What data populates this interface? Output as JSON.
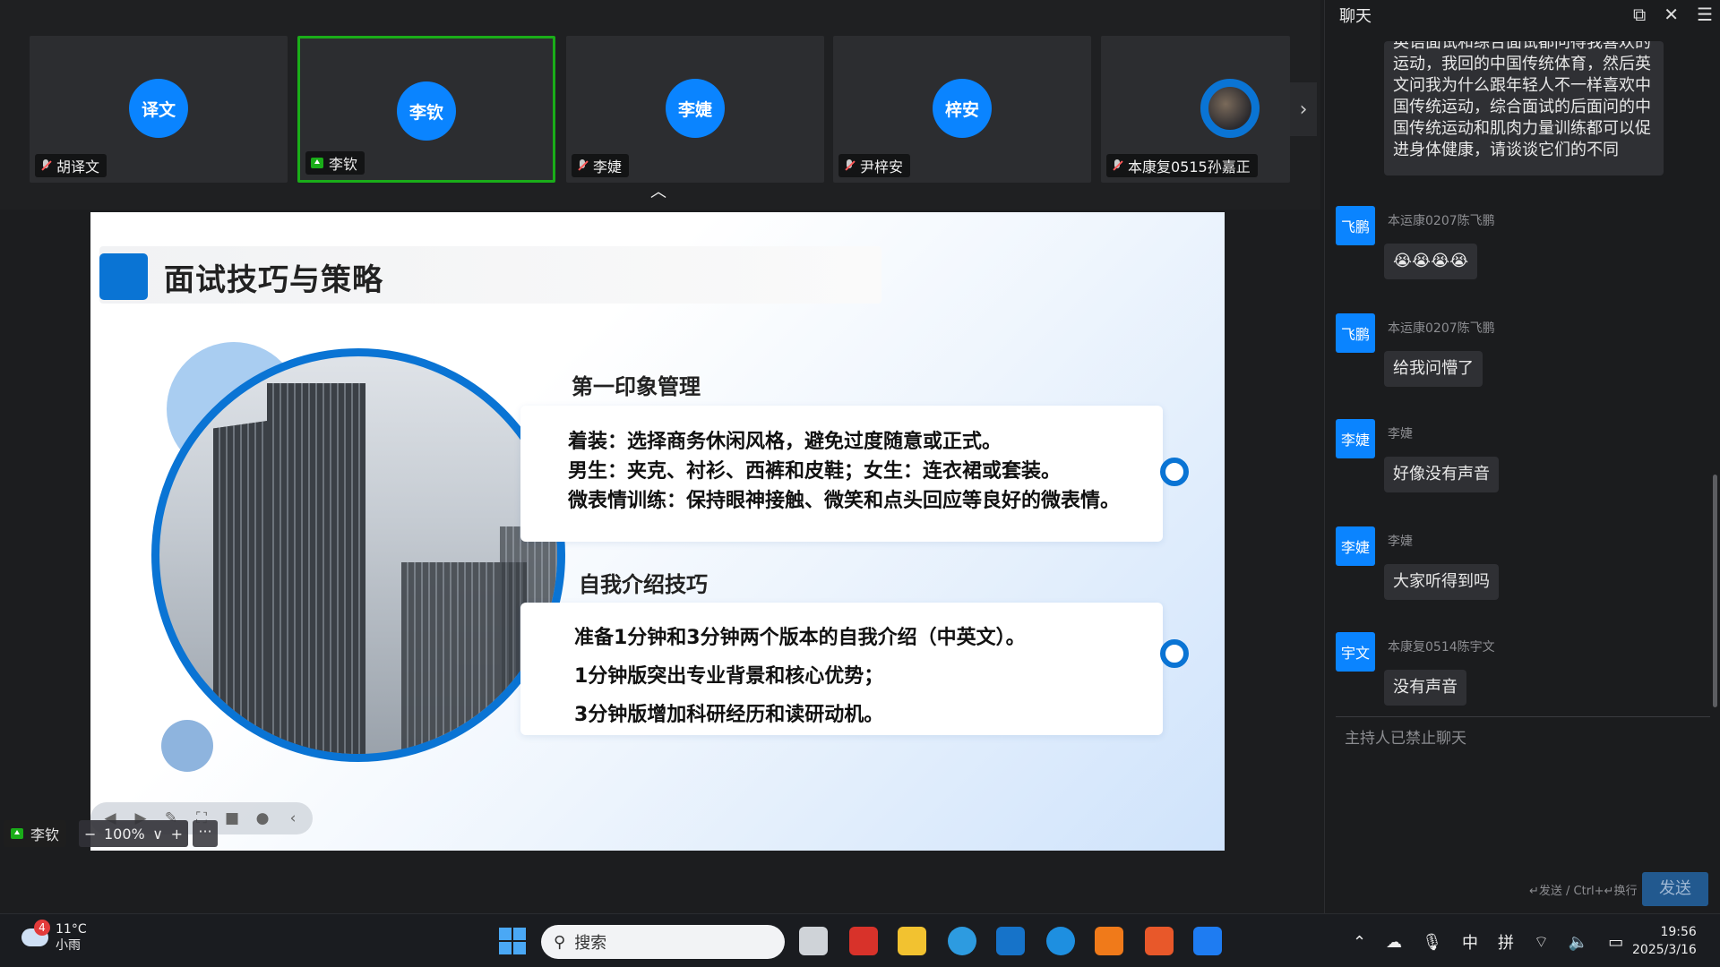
{
  "participants": [
    {
      "avatar": "译文",
      "name": "胡译文",
      "status": "mic-off"
    },
    {
      "avatar": "李钦",
      "name": "李钦",
      "status": "sharing"
    },
    {
      "avatar": "李婕",
      "name": "李婕",
      "status": "mic-off"
    },
    {
      "avatar": "梓安",
      "name": "尹梓安",
      "status": "mic-off"
    },
    {
      "avatar": "",
      "name": "本康复0515孙嘉正",
      "status": "mic-off"
    }
  ],
  "slide": {
    "title": "面试技巧与策略",
    "section1": {
      "title": "第一印象管理",
      "lines": [
        "着装：选择商务休闲风格，避免过度随意或正式。",
        "男生：夹克、衬衫、西裤和皮鞋；女生：连衣裙或套装。",
        "微表情训练：保持眼神接触、微笑和点头回应等良好的微表情。"
      ]
    },
    "section2": {
      "title": "自我介绍技巧",
      "lines": [
        "准备1分钟和3分钟两个版本的自我介绍（中英文）。",
        "1分钟版突出专业背景和核心优势；",
        "3分钟版增加科研经历和读研动机。"
      ]
    }
  },
  "sharer": {
    "name": "李钦"
  },
  "zoom": {
    "level": "100%",
    "minus": "−",
    "plus": "+",
    "caret": "∨",
    "more": "···"
  },
  "chat": {
    "title": "聊天",
    "top_message": "英语面试和综合面试都问得我喜欢的运动，我回的中国传统体育，然后英文问我为什么跟年轻人不一样喜欢中国传统运动，综合面试的后面问的中国传统运动和肌肉力量训练都可以促进身体健康，请谈谈它们的不同",
    "messages": [
      {
        "avatar": "飞鹏",
        "sender": "本运康0207陈飞鹏",
        "text": "😭😭😭😭"
      },
      {
        "avatar": "飞鹏",
        "sender": "本运康0207陈飞鹏",
        "text": "给我问懵了"
      },
      {
        "avatar": "李婕",
        "sender": "李婕",
        "text": "好像没有声音"
      },
      {
        "avatar": "李婕",
        "sender": "李婕",
        "text": "大家听得到吗"
      },
      {
        "avatar": "宇文",
        "sender": "本康复0514陈宇文",
        "text": "没有声音"
      }
    ],
    "banned_notice": "主持人已禁止聊天",
    "hint": "↵发送 / Ctrl+↵换行",
    "send_label": "发送"
  },
  "taskbar": {
    "weather_badge": "4",
    "temperature": "11°C",
    "condition": "小雨",
    "search_placeholder": "搜索",
    "ime_lang": "中",
    "ime_mode": "拼",
    "time": "19:56",
    "date": "2025/3/16"
  },
  "colors": {
    "accent": "#0a84ff",
    "slide_blue": "#0a74d4",
    "active_border": "#1aad19"
  }
}
